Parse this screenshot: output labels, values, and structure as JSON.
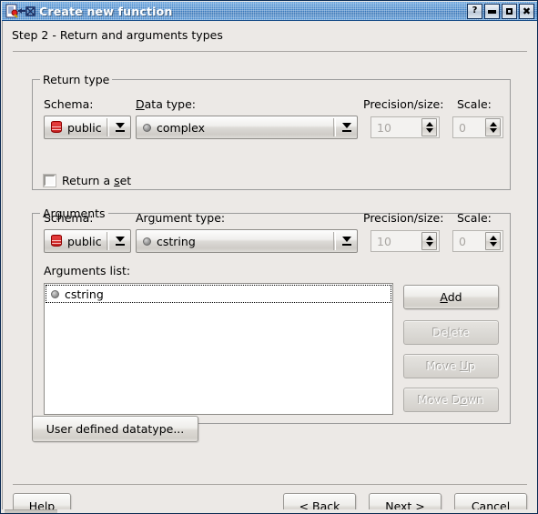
{
  "window": {
    "title": "Create new function",
    "icon": "function-document-icon",
    "controls": [
      {
        "name": "help",
        "glyph": "?"
      },
      {
        "name": "minimize",
        "glyph": ""
      },
      {
        "name": "maximize",
        "glyph": ""
      },
      {
        "name": "close",
        "glyph": "✖"
      }
    ]
  },
  "step": {
    "label": "Step 2 - Return and arguments types"
  },
  "return_type": {
    "group_title": "Return type",
    "schema_label": "Schema:",
    "schema_value": "public",
    "schema_icon": "database-icon",
    "data_type_label_pre": "",
    "data_type_label_mnemonic": "D",
    "data_type_label_post": "ata type:",
    "data_type_value": "complex",
    "data_type_icon": "sphere-icon",
    "precision_label": "Precision/size:",
    "precision_value": "10",
    "precision_enabled": false,
    "scale_label": "Scale:",
    "scale_value": "0",
    "scale_enabled": false,
    "return_set_pre": "Return a ",
    "return_set_mnemonic": "s",
    "return_set_post": "et",
    "return_set_checked": false
  },
  "arguments": {
    "group_title": "Arguments",
    "schema_label": "Schema:",
    "schema_value": "public",
    "schema_icon": "database-icon",
    "arg_type_label_pre": "Ar",
    "arg_type_label_mnemonic": "g",
    "arg_type_label_post": "ument type:",
    "arg_type_value": "cstring",
    "arg_type_icon": "sphere-icon",
    "precision_label": "Precision/size:",
    "precision_value": "10",
    "precision_enabled": false,
    "scale_label": "Scale:",
    "scale_value": "0",
    "scale_enabled": false,
    "list_label": "Arguments list:",
    "list_items": [
      {
        "icon": "sphere-icon",
        "text": "cstring",
        "selected": true
      }
    ],
    "buttons": [
      {
        "name": "add",
        "pre": "",
        "mnemonic": "A",
        "post": "dd",
        "enabled": true
      },
      {
        "name": "delete",
        "pre": "De",
        "mnemonic": "l",
        "post": "ete",
        "enabled": false
      },
      {
        "name": "move-up",
        "pre": "Move ",
        "mnemonic": "U",
        "post": "p",
        "enabled": false
      },
      {
        "name": "move-down",
        "pre": "Move D",
        "mnemonic": "o",
        "post": "wn",
        "enabled": false
      }
    ]
  },
  "user_defined": {
    "label": "User defined datatype..."
  },
  "footer": {
    "help": {
      "pre": "",
      "mnemonic": "H",
      "post": "elp"
    },
    "back": {
      "pre": "< ",
      "mnemonic": "B",
      "post": "ack"
    },
    "next": {
      "pre": "",
      "mnemonic": "N",
      "post": "ext >"
    },
    "cancel": {
      "pre": "",
      "mnemonic": "C",
      "post": "ancel"
    }
  },
  "colors": {
    "titlebar_start": "#5d9ddb",
    "titlebar_end": "#2f6fb5",
    "window_bg": "#ece9e6",
    "border": "#9a9a9a",
    "db_icon_red": "#d42020",
    "disabled_text": "#a9a6a2"
  }
}
